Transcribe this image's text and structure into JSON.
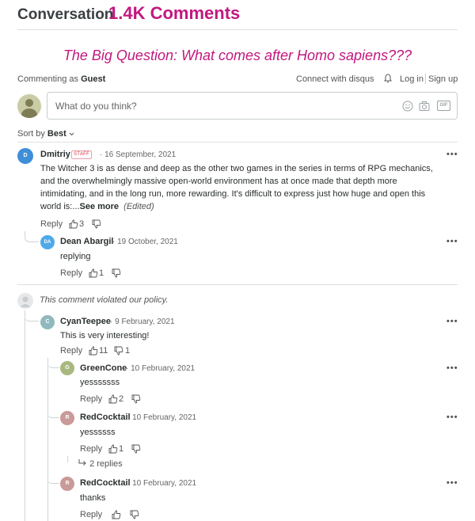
{
  "header": {
    "title": "Conversation",
    "count": "1.4K Comments"
  },
  "big_question": "The Big Question: What comes after Homo sapiens???",
  "auth": {
    "commenting_as_prefix": "Commenting as",
    "commenting_as_user": "Guest",
    "connect": "Connect with disqus",
    "login": "Log in",
    "signup": "Sign up"
  },
  "composer": {
    "placeholder": "What do you think?",
    "gif": "GIF"
  },
  "sort": {
    "prefix": "Sort by",
    "value": "Best"
  },
  "comments": {
    "c1": {
      "initial": "D",
      "author": "Dmitriy",
      "badge": "STAFF",
      "date": "16 September, 2021",
      "text": "The Witcher 3 is as dense and deep as the other two games in the series in terms of RPG mechanics, and the overwhelmingly massive open-world environment has at once made that depth more intimidating, and in the long run, more rewarding. It's difficult to express just how huge and open this world is:...",
      "see_more": "See more",
      "edited": "(Edited)",
      "reply": "Reply",
      "upvotes": "3",
      "avatar_color": "#3e8fd8"
    },
    "c2": {
      "initial": "DA",
      "author": "Dean Abargil",
      "date": "19 October, 2021",
      "text": "replying",
      "reply": "Reply",
      "upvotes": "1",
      "avatar_color": "#4fa9e8"
    },
    "c3": {
      "violated": "This comment violated our policy."
    },
    "c4": {
      "initial": "C",
      "author": "CyanTeepee",
      "date": "9 February, 2021",
      "text": "This is very interesting!",
      "reply": "Reply",
      "upvotes": "11",
      "downvotes": "1",
      "avatar_color": "#8fb9bf"
    },
    "c5": {
      "initial": "G",
      "author": "GreenCone",
      "date": "10 February, 2021",
      "text": "yesssssss",
      "reply": "Reply",
      "upvotes": "2",
      "avatar_color": "#a8b97f"
    },
    "c6": {
      "initial": "R",
      "author": "RedCocktail",
      "date": "10 February, 2021",
      "text": "yessssss",
      "reply": "Reply",
      "upvotes": "1",
      "replies": "2 replies",
      "avatar_color": "#c99a97"
    },
    "c7": {
      "initial": "R",
      "author": "RedCocktail",
      "date": "10 February, 2021",
      "text": "thanks",
      "reply": "Reply",
      "avatar_color": "#c99a97"
    }
  },
  "menu_glyph": "•••"
}
